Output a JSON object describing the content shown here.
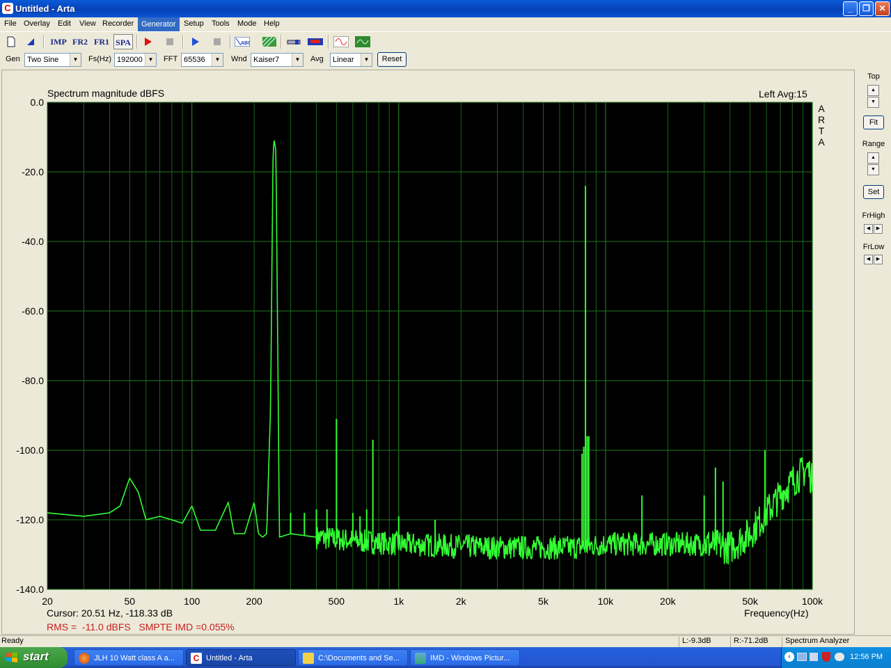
{
  "window": {
    "title": "Untitled - Arta",
    "minimize": "_",
    "maximize": "❐",
    "close": "✕"
  },
  "menu": [
    "File",
    "Overlay",
    "Edit",
    "View",
    "Recorder",
    "Generator",
    "Setup",
    "Tools",
    "Mode",
    "Help"
  ],
  "menu_active": "Generator",
  "toolbar": {
    "imp": "IMP",
    "fr2": "FR2",
    "fr1": "FR1",
    "spa": "SPA"
  },
  "controls": {
    "gen_label": "Gen",
    "gen_value": "Two Sine",
    "fs_label": "Fs(Hz)",
    "fs_value": "192000",
    "fft_label": "FFT",
    "fft_value": "65536",
    "wnd_label": "Wnd",
    "wnd_value": "Kaiser7",
    "avg_label": "Avg",
    "avg_value": "Linear",
    "reset_label": "Reset"
  },
  "plot_header": {
    "title": "Spectrum magnitude dBFS",
    "channel": "Left  Avg:15",
    "watermark": "A R T A",
    "cursor": "Cursor: 20.51 Hz, -118.33 dB",
    "xaxis_label": "Frequency(Hz)",
    "rms": "RMS =  -11.0 dBFS   SMPTE IMD =0.055%"
  },
  "right_panel": {
    "top": "Top",
    "fit": "Fit",
    "range": "Range",
    "set": "Set",
    "frhigh": "FrHigh",
    "frlow": "FrLow"
  },
  "status": {
    "ready": "Ready",
    "left": "L:-9.3dB",
    "right": "R:-71.2dB",
    "mode": "Spectrum Analyzer"
  },
  "taskbar": {
    "start": "start",
    "tasks": [
      "JLH 10 Watt class A a...",
      "Untitled - Arta",
      "C:\\Documents and Se...",
      "IMD - Windows Pictur..."
    ],
    "clock": "12:56 PM"
  },
  "colors": {
    "trace": "#33ff33",
    "plot_bg": "#000000",
    "grid": "#1f7a1f",
    "rms_text": "#c81e1e"
  },
  "chart_data": {
    "type": "line",
    "title": "Spectrum magnitude dBFS",
    "xlabel": "Frequency(Hz)",
    "ylabel": "",
    "xscale": "log",
    "xlim": [
      20,
      100000
    ],
    "ylim": [
      -140,
      0
    ],
    "yticks": [
      "0.0",
      "-20.0",
      "-40.0",
      "-60.0",
      "-80.0",
      "-100.0",
      "-120.0",
      "-140.0"
    ],
    "xticks": [
      "20",
      "50",
      "100",
      "200",
      "500",
      "1k",
      "2k",
      "5k",
      "10k",
      "20k",
      "50k",
      "100k"
    ],
    "grid": true,
    "series": [
      {
        "noise_floor": [
          [
            20,
            -118
          ],
          [
            30,
            -119
          ],
          [
            40,
            -118
          ],
          [
            45,
            -116
          ],
          [
            50,
            -108
          ],
          [
            55,
            -112
          ],
          [
            60,
            -120
          ],
          [
            70,
            -119
          ],
          [
            80,
            -120
          ],
          [
            90,
            -121
          ],
          [
            100,
            -116
          ],
          [
            110,
            -123
          ],
          [
            130,
            -123
          ],
          [
            150,
            -115
          ],
          [
            160,
            -124
          ],
          [
            180,
            -124
          ],
          [
            200,
            -115
          ],
          [
            210,
            -124
          ],
          [
            220,
            -125
          ],
          [
            230,
            -124
          ],
          [
            240,
            -88
          ],
          [
            247,
            -14
          ],
          [
            250,
            -11
          ],
          [
            255,
            -14
          ],
          [
            265,
            -125
          ],
          [
            300,
            -124
          ],
          [
            400,
            -125
          ],
          [
            600,
            -126
          ],
          [
            1000,
            -127
          ],
          [
            3000,
            -128
          ],
          [
            7000,
            -128
          ],
          [
            10000,
            -127
          ],
          [
            20000,
            -127
          ],
          [
            30000,
            -127
          ],
          [
            40000,
            -128
          ],
          [
            50000,
            -124
          ],
          [
            60000,
            -118
          ],
          [
            70000,
            -113
          ],
          [
            80000,
            -109
          ],
          [
            95000,
            -105
          ],
          [
            100000,
            -109
          ]
        ],
        "peaks": [
          [
            250,
            -11.5
          ],
          [
            300,
            -118
          ],
          [
            350,
            -118
          ],
          [
            400,
            -117
          ],
          [
            450,
            -117
          ],
          [
            500,
            -91
          ],
          [
            600,
            -118
          ],
          [
            650,
            -119
          ],
          [
            700,
            -117
          ],
          [
            750,
            -97
          ],
          [
            1000,
            -119
          ],
          [
            1500,
            -120
          ],
          [
            7700,
            -101
          ],
          [
            7850,
            -99
          ],
          [
            8000,
            -24
          ],
          [
            8150,
            -96
          ],
          [
            8300,
            -96
          ],
          [
            15000,
            -113
          ],
          [
            30000,
            -113
          ],
          [
            34000,
            -105
          ],
          [
            37000,
            -109
          ],
          [
            59000,
            -100
          ]
        ]
      }
    ]
  }
}
